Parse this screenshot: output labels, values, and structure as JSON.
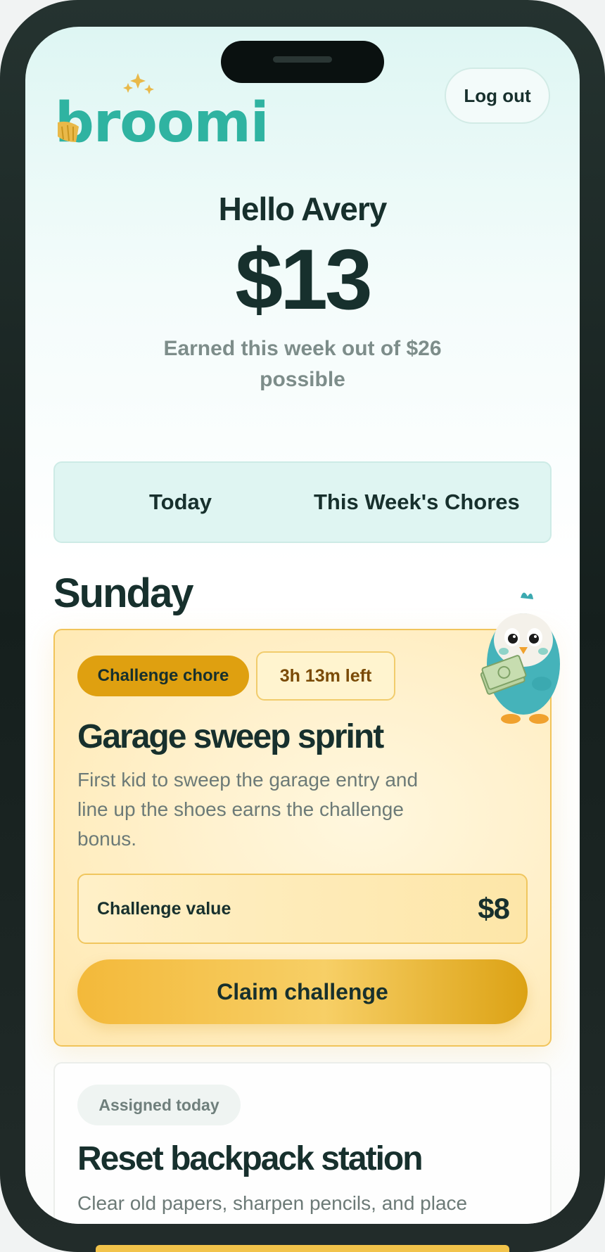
{
  "header": {
    "logo_text": "broomi",
    "logout_label": "Log out"
  },
  "summary": {
    "greeting": "Hello Avery",
    "earned_amount": "$13",
    "subtitle": "Earned this week out of $26 possible"
  },
  "tabs": [
    {
      "label": "Today"
    },
    {
      "label": "This Week's Chores"
    }
  ],
  "day_heading": "Sunday",
  "challenge_card": {
    "badge": "Challenge chore",
    "time_left": "3h 13m left",
    "title": "Garage sweep sprint",
    "description": "First kid to sweep the garage entry and line up the shoes earns the challenge bonus.",
    "value_label": "Challenge value",
    "value_amount": "$8",
    "claim_label": "Claim challenge",
    "mascot_icon": "penguin-holding-money"
  },
  "assigned_card": {
    "badge": "Assigned today",
    "title": "Reset backpack station",
    "description": "Clear old papers, sharpen pencils, and place"
  },
  "colors": {
    "brand_teal": "#2fb3a1",
    "brand_gold": "#e9b949",
    "challenge_badge": "#dfa010",
    "text_dark": "#17302d"
  }
}
